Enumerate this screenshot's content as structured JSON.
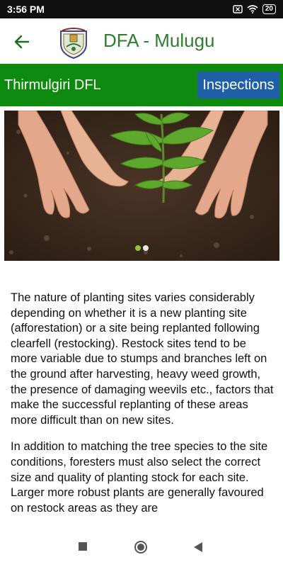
{
  "status": {
    "time": "3:56 PM",
    "battery": "20",
    "icons": [
      "screen-record-icon",
      "wifi-icon",
      "battery-icon"
    ]
  },
  "appbar": {
    "title": "DFA - Mulugu",
    "back_icon": "arrow-left-icon",
    "logo": "emblem-logo"
  },
  "location_bar": {
    "location": "Thirmulgiri DFL",
    "inspections_label": "Inspections",
    "bg_color": "#0e8a0e",
    "button_color": "#1f5fa8"
  },
  "slider": {
    "slide_count": 2,
    "active_index": 0
  },
  "content": {
    "paragraphs": [
      "The nature of planting sites varies considerably depending on whether it is a new planting site (afforestation) or a site being replanted following clearfell (restocking).  Restock sites tend to be more variable due to stumps and branches left on the ground after harvesting, heavy weed growth, the presence of damaging weevils etc., factors that make the successful replanting of these areas more difficult than on new sites.",
      "In addition to matching the tree species to the site conditions, foresters must also select the correct size and quality of planting stock for each site. Larger more robust plants are generally favoured on restock areas as they are"
    ]
  },
  "navbar": {
    "buttons": [
      "recents-square-icon",
      "home-circle-icon",
      "back-triangle-icon"
    ]
  }
}
